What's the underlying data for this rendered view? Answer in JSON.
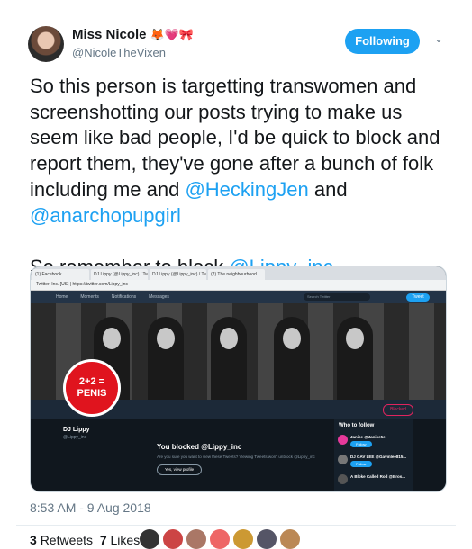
{
  "author": {
    "name": "Miss Nicole",
    "emojis": "🦊💗🎀",
    "handle": "@NicoleTheVixen",
    "follow_label": "Following"
  },
  "tweet": {
    "text_1": "So this person is targetting transwomen and screenshotting our posts trying to make us seem like bad people, I'd be quick to block and report them, they've gone after a bunch of folk including me and ",
    "mention_1": "@HeckingJen",
    "text_and": " and ",
    "mention_2": "@anarchopupgirl",
    "text_2": "So remember to block ",
    "mention_3": "@Lippy_inc"
  },
  "screenshot": {
    "tabs": [
      "(1) Facebook",
      "DJ Lippy (@Lippy_inc) / Tw",
      "DJ Lippy (@Lippy_inc) / Tw",
      "(2) The neighbourhood"
    ],
    "address": "Twitter, Inc. [US] | https://twitter.com/Lippy_inc",
    "nav": [
      "Home",
      "Moments",
      "Notifications",
      "Messages"
    ],
    "search_placeholder": "Search Twitter",
    "tweet_button": "Tweet",
    "logo_text": "2+2 = PENIS",
    "blocked_button": "Blocked",
    "profile_name": "DJ Lippy",
    "profile_handle": "@Lippy_inc",
    "blocked_title": "You blocked @Lippy_inc",
    "blocked_subtitle": "Are you sure you want to view these Tweets? Viewing Tweets won't unblock @Lippy_inc",
    "view_profile": "Yes, view profile",
    "who_to_follow": "Who to follow",
    "suggestions": [
      {
        "name": "Janice @Janice5e",
        "follow": "Follow"
      },
      {
        "name": "DJ GAV LEE @Gavinlee815...",
        "follow": "Follow"
      },
      {
        "name": "A Bloke Called Rod @Bros...",
        "follow": "Follow"
      }
    ]
  },
  "timestamp": "8:53 AM - 9 Aug 2018",
  "stats": {
    "retweets_count": "3",
    "retweets_label": "Retweets",
    "likes_count": "7",
    "likes_label": "Likes"
  },
  "colors": {
    "accent": "#1da1f2",
    "blocked": "#e0245e"
  }
}
